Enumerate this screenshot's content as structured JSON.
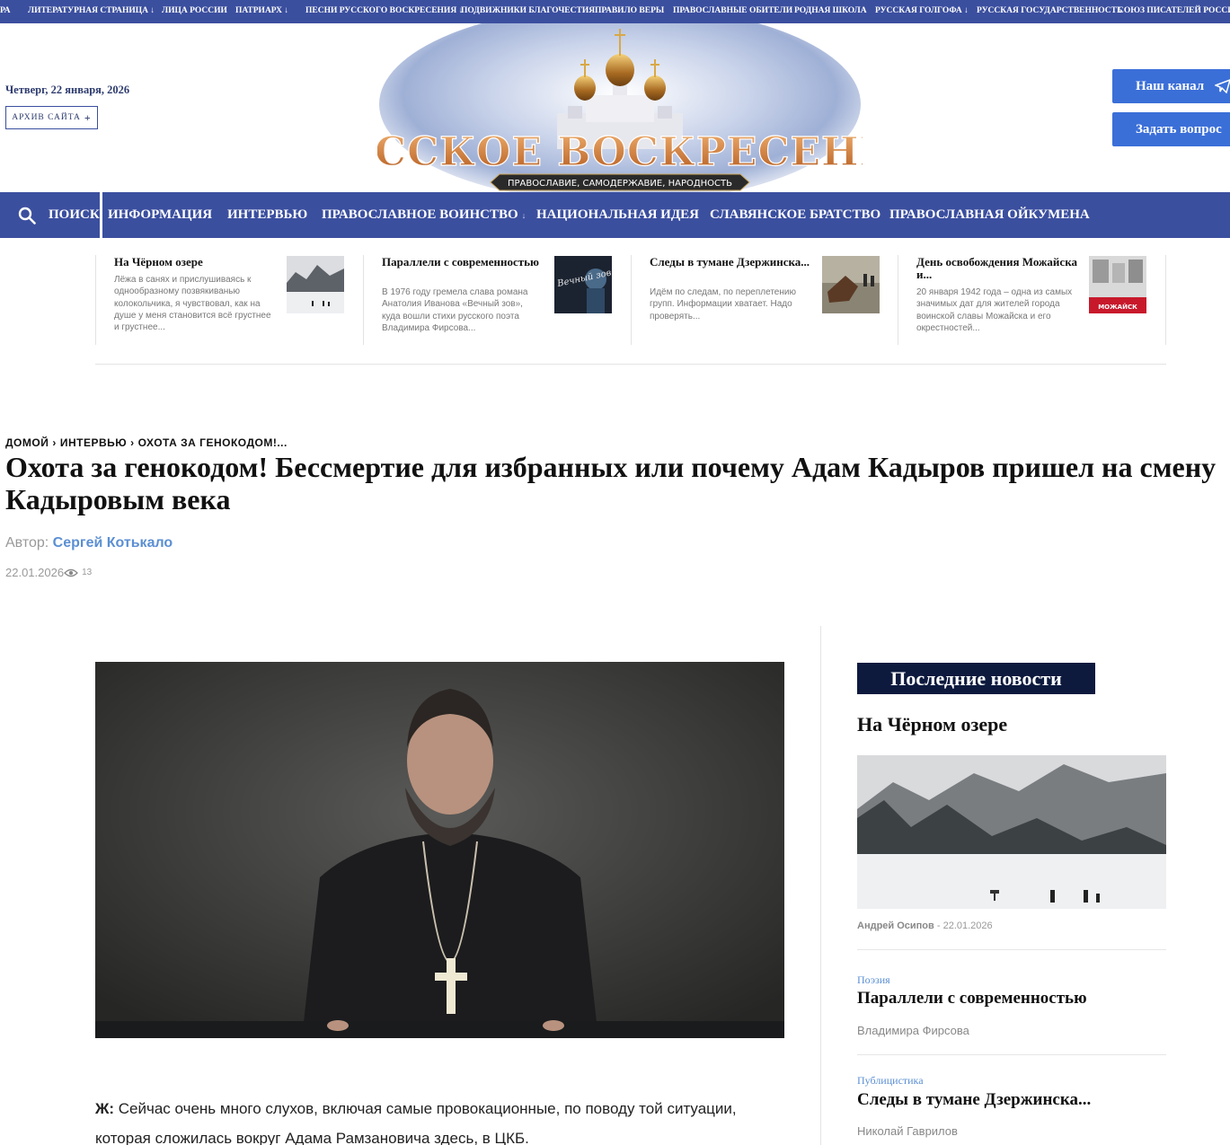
{
  "topnav": {
    "items": [
      {
        "label": "РА"
      },
      {
        "label": "ЛИТЕРАТУРНАЯ СТРАНИЦА",
        "arrow": "↓"
      },
      {
        "label": "ЛИЦА РОССИИ"
      },
      {
        "label": "ПАТРИАРХ",
        "arrow": "↓"
      },
      {
        "label": "ПЕСНИ РУССКОГО ВОСКРЕСЕНИЯ",
        "arrow": "↓"
      },
      {
        "label": "ПОДВИЖНИКИ БЛАГОЧЕСТИЯ"
      },
      {
        "label": "ПРАВИЛО ВЕРЫ"
      },
      {
        "label": "ПРАВОСЛАВНЫЕ ОБИТЕЛИ"
      },
      {
        "label": "РОДНАЯ ШКОЛА"
      },
      {
        "label": "РУССКАЯ ГОЛГОФА",
        "arrow": "↓"
      },
      {
        "label": "РУССКАЯ ГОСУДАРСТВЕННОСТЬ"
      },
      {
        "label": "СОЮЗ ПИСАТЕЛЕЙ РОССИИ"
      }
    ]
  },
  "header": {
    "date": "Четверг, 22 января, 2026",
    "archive_label": "АРХИВ САЙТА",
    "archive_icon": "+",
    "logo_title": "РУССКОЕ ВОСКРЕСЕНИЕ",
    "logo_tagline": "ПРАВОСЛАВИЕ, САМОДЕРЖАВИЕ, НАРОДНОСТЬ",
    "channel_button": "Наш канал",
    "ask_button": "Задать вопрос"
  },
  "mainnav": {
    "search_label": "ПОИСК",
    "items": [
      {
        "label": "ИНФОРМАЦИЯ"
      },
      {
        "label": "ИНТЕРВЬЮ"
      },
      {
        "label": "ПРАВОСЛАВНОЕ ВОИНСТВО",
        "arrow": "↓"
      },
      {
        "label": "НАЦИОНАЛЬНАЯ ИДЕЯ"
      },
      {
        "label": "СЛАВЯНСКОЕ БРАТСТВО"
      },
      {
        "label": "ПРАВОСЛАВНАЯ ОЙКУМЕНА"
      }
    ]
  },
  "carousel": [
    {
      "title": "На Чёрном озере",
      "desc": "Лёжа в санях и прислушиваясь к однообразному позвякиванью колокольчика, я чувствовал, как на душе у меня становится всё грустнее и грустнее..."
    },
    {
      "title": "Параллели с современностью",
      "desc": "В 1976 году гремела слава романа Анатолия Иванова «Вечный зов», куда вошли стихи русского поэта Владимира Фирсова...",
      "thumb_text": "Вечный зов"
    },
    {
      "title": "Следы в тумане Дзержинска...",
      "desc": "Идём по следам, по переплетению групп. Информации хватает. Надо проверять..."
    },
    {
      "title": "День освобождения Можайска и...",
      "desc": "20 января 1942 года – одна из самых значимых дат для жителей города воинской славы Можайска и его окрестностей...",
      "thumb_text": "МОЖАЙСК"
    }
  ],
  "article": {
    "breadcrumbs": [
      "ДОМОЙ",
      "ИНТЕРВЬЮ",
      "ОХОТА ЗА ГЕНОКОДОМ!..."
    ],
    "crumb_sep": "›",
    "title": "Охота за генокодом! Бессмертие для избранных или почему Адам Кадыров пришел на смену Кадыровым века",
    "author_prefix": "Автор:",
    "author_name": "Сергей Котькало",
    "date": "22.01.2026",
    "views": "13",
    "para_label": "Ж:",
    "para_text": " Сейчас очень много слухов, включая самые провокационные, по поводу той ситуации, которая сложилась вокруг Адама Рамзановича здесь, в ЦКБ."
  },
  "sidebar": {
    "heading": "Последние новости",
    "top_title": "На Чёрном озере",
    "top_author": "Андрей Осипов",
    "top_date": "- 22.01.2026",
    "items": [
      {
        "category": "Поэзия",
        "title": "Параллели с современностью",
        "author": "Владимира Фирсова"
      },
      {
        "category": "Публицистика",
        "title": "Следы в тумане Дзержинска...",
        "author": "Николай Гаврилов"
      }
    ]
  },
  "colors": {
    "nav_blue": "#3b4f9f",
    "button_blue": "#3b6fd8",
    "sidebar_heading_bg": "#0d1a3e",
    "link_blue": "#5b8fd3"
  }
}
